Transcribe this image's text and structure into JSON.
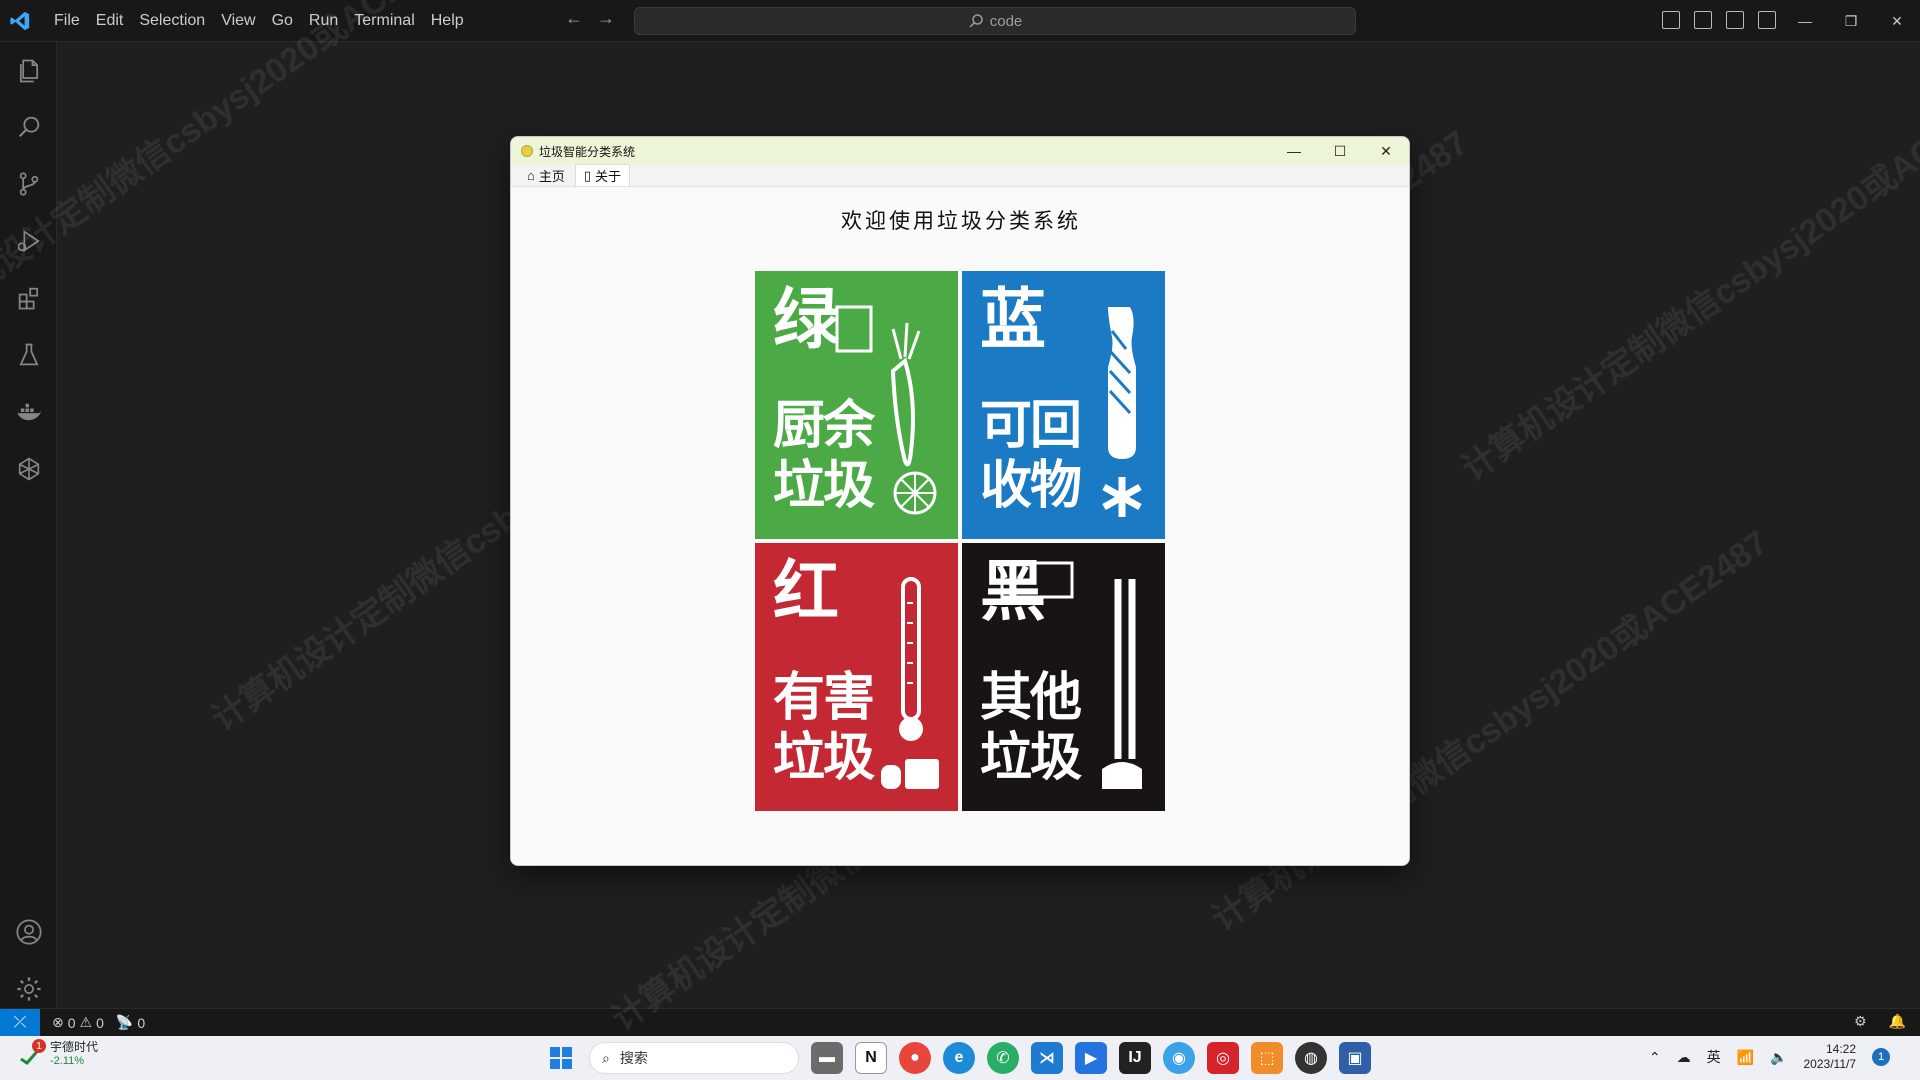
{
  "titlebar": {
    "menu": [
      "File",
      "Edit",
      "Selection",
      "View",
      "Go",
      "Run",
      "Terminal",
      "Help"
    ],
    "search_text": "code"
  },
  "statusbar": {
    "errors": "0",
    "warnings": "0",
    "ports": "0"
  },
  "app": {
    "title": "垃圾智能分类系统",
    "tabs": [
      {
        "label": "主页"
      },
      {
        "label": "关于"
      }
    ],
    "welcome": "欢迎使用垃圾分类系统",
    "tiles": [
      {
        "big": "绿",
        "line1": "厨余",
        "line2": "垃圾",
        "color": "#4caa46"
      },
      {
        "big": "蓝",
        "line1": "可回",
        "line2": "收物",
        "color": "#1a7ac4"
      },
      {
        "big": "红",
        "line1": "有害",
        "line2": "垃圾",
        "color": "#c32833"
      },
      {
        "big": "黑",
        "line1": "其他",
        "line2": "垃圾",
        "color": "#181314"
      }
    ]
  },
  "taskbar": {
    "stock_name": "宇德时代",
    "stock_change": "-2.11%",
    "stock_badge": "1",
    "search_placeholder": "搜索",
    "tray_lang": "英",
    "time": "14:22",
    "date": "2023/11/7",
    "notification_count": "1"
  },
  "watermark_text": "计算机设计定制微信csbysj2020或ACE2487"
}
